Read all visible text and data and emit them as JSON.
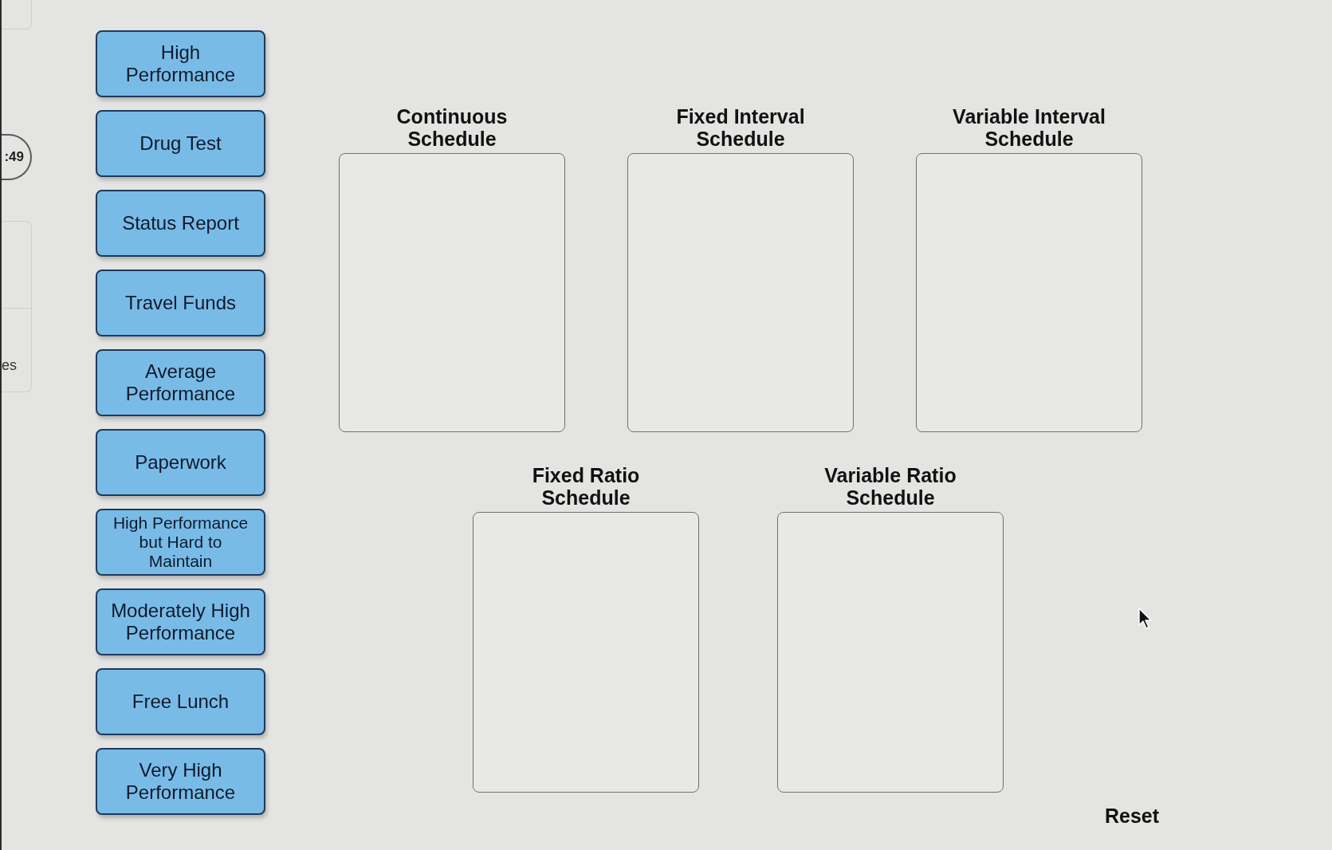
{
  "left_edge": {
    "badge": ":49",
    "panel_label": "es"
  },
  "cards": [
    {
      "label": "High Performance"
    },
    {
      "label": "Drug Test"
    },
    {
      "label": "Status Report"
    },
    {
      "label": "Travel Funds"
    },
    {
      "label": "Average Performance"
    },
    {
      "label": "Paperwork"
    },
    {
      "label": "High Performance but Hard to Maintain"
    },
    {
      "label": "Moderately High Performance"
    },
    {
      "label": "Free Lunch"
    },
    {
      "label": "Very High Performance"
    }
  ],
  "drop_zone_rows": [
    {
      "zones": [
        {
          "heading": "Continuous Schedule"
        },
        {
          "heading": "Fixed Interval Schedule"
        },
        {
          "heading": "Variable Interval Schedule"
        }
      ]
    },
    {
      "zones": [
        {
          "heading": "Fixed Ratio Schedule"
        },
        {
          "heading": "Variable Ratio Schedule"
        }
      ]
    }
  ],
  "reset_button": {
    "label": "Reset"
  }
}
